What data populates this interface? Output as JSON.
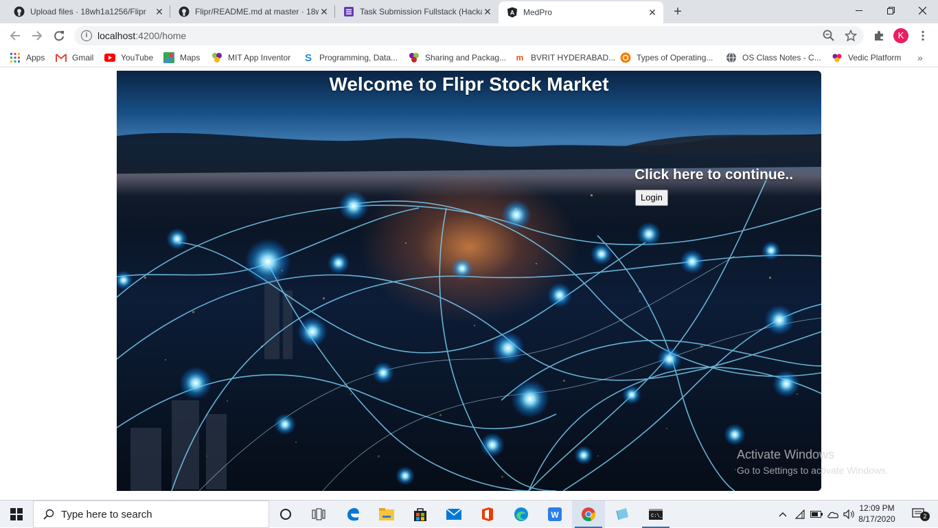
{
  "browser": {
    "tabs": [
      {
        "title": "Upload files · 18wh1a1256/Flipr",
        "favicon": "github-icon"
      },
      {
        "title": "Flipr/README.md at master · 18wh",
        "favicon": "github-icon"
      },
      {
        "title": "Task Submission Fullstack (Hacka",
        "favicon": "forms-icon"
      },
      {
        "title": "MedPro",
        "favicon": "angular-icon",
        "active": true
      }
    ],
    "url_host": "localhost",
    "url_rest": ":4200/home",
    "profile_initial": "K"
  },
  "bookmarks": [
    {
      "label": "Apps",
      "icon": "apps-grid-icon"
    },
    {
      "label": "Gmail",
      "icon": "gmail-icon"
    },
    {
      "label": "YouTube",
      "icon": "youtube-icon"
    },
    {
      "label": "Maps",
      "icon": "maps-icon"
    },
    {
      "label": "MIT App Inventor",
      "icon": "mit-app-inventor-icon"
    },
    {
      "label": "Programming, Data...",
      "icon": "s-icon"
    },
    {
      "label": "Sharing and Packag...",
      "icon": "sharing-icon"
    },
    {
      "label": "BVRIT HYDERABAD...",
      "icon": "bvrit-icon"
    },
    {
      "label": "Types of Operating...",
      "icon": "ubuntu-icon"
    },
    {
      "label": "OS Class Notes - C...",
      "icon": "globe-icon"
    },
    {
      "label": "Vedic Platform",
      "icon": "vedic-icon"
    }
  ],
  "page": {
    "title": "Welcome to Flipr Stock Market",
    "cta": "Click here to continue..",
    "login_label": "Login"
  },
  "watermark": {
    "line1": "Activate Windows",
    "line2": "Go to Settings to activate Windows."
  },
  "taskbar": {
    "search_placeholder": "Type here to search",
    "time": "12:09 PM",
    "date": "8/17/2020",
    "notification_count": "2"
  }
}
